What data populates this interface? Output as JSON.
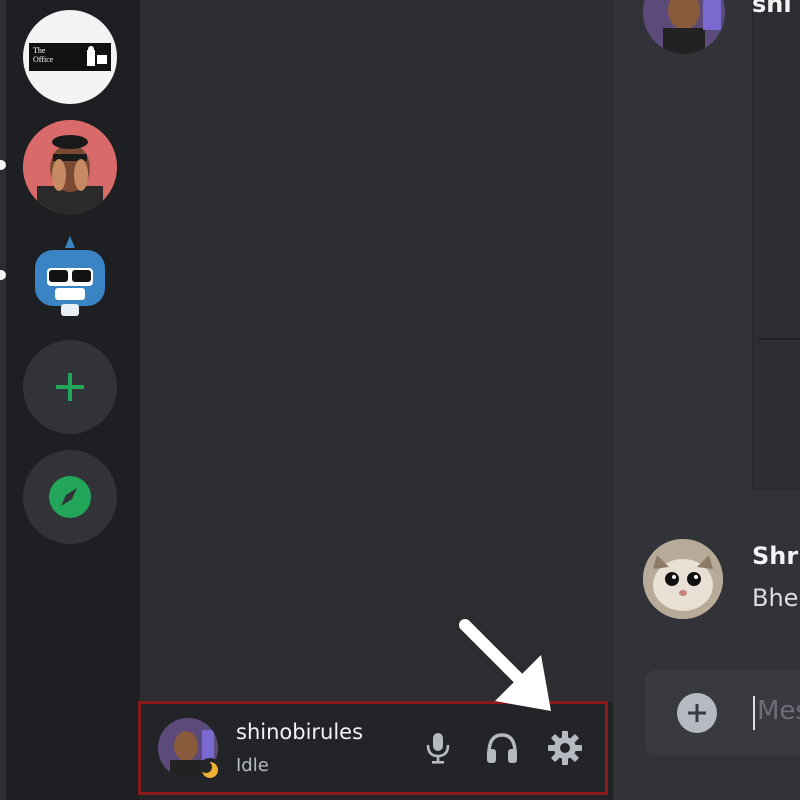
{
  "servers": [
    {
      "name": "The Office",
      "logo_text": [
        "The",
        "Office"
      ]
    },
    {
      "name": "friend-server-avatar"
    },
    {
      "name": "bot-server-avatar"
    }
  ],
  "server_actions": {
    "add": "+",
    "explore": "explore"
  },
  "chat": {
    "first_author_truncated": "shi",
    "second_author_truncated": "Shr",
    "second_message_truncated": "Bhe",
    "composer_placeholder": "Mes"
  },
  "user_panel": {
    "username": "shinobirules",
    "status": "Idle"
  },
  "colors": {
    "accent_green": "#23a55a",
    "idle_yellow": "#f0b232",
    "highlight_border": "#8b1a1a"
  },
  "icons": [
    "microphone-icon",
    "headphones-icon",
    "settings-gear-icon",
    "plus-icon",
    "compass-icon",
    "arrow-icon",
    "idle-moon-icon"
  ]
}
